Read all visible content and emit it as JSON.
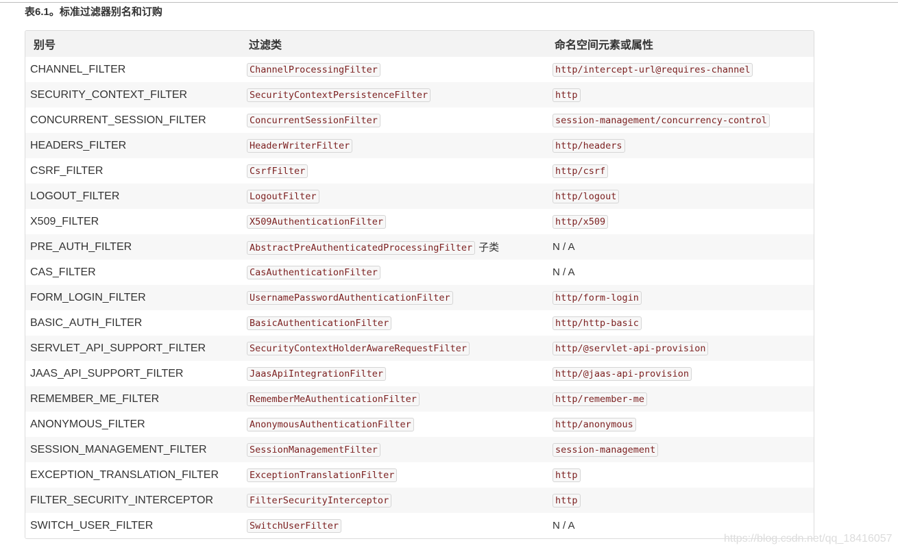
{
  "caption": "表6.1。标准过滤器别名和订购",
  "table": {
    "headers": [
      "别号",
      "过滤类",
      "命名空间元素或属性"
    ],
    "rows": [
      {
        "alias": "CHANNEL_FILTER",
        "filter_class": "ChannelProcessingFilter",
        "filter_suffix": "",
        "namespace": "http/intercept-url@requires-channel",
        "namespace_is_code": true
      },
      {
        "alias": "SECURITY_CONTEXT_FILTER",
        "filter_class": "SecurityContextPersistenceFilter",
        "filter_suffix": "",
        "namespace": "http",
        "namespace_is_code": true
      },
      {
        "alias": "CONCURRENT_SESSION_FILTER",
        "filter_class": "ConcurrentSessionFilter",
        "filter_suffix": "",
        "namespace": "session-management/concurrency-control",
        "namespace_is_code": true
      },
      {
        "alias": "HEADERS_FILTER",
        "filter_class": "HeaderWriterFilter",
        "filter_suffix": "",
        "namespace": "http/headers",
        "namespace_is_code": true
      },
      {
        "alias": "CSRF_FILTER",
        "filter_class": "CsrfFilter",
        "filter_suffix": "",
        "namespace": "http/csrf",
        "namespace_is_code": true
      },
      {
        "alias": "LOGOUT_FILTER",
        "filter_class": "LogoutFilter",
        "filter_suffix": "",
        "namespace": "http/logout",
        "namespace_is_code": true
      },
      {
        "alias": "X509_FILTER",
        "filter_class": "X509AuthenticationFilter",
        "filter_suffix": "",
        "namespace": "http/x509",
        "namespace_is_code": true
      },
      {
        "alias": "PRE_AUTH_FILTER",
        "filter_class": "AbstractPreAuthenticatedProcessingFilter",
        "filter_suffix": "子类",
        "namespace": "N / A",
        "namespace_is_code": false
      },
      {
        "alias": "CAS_FILTER",
        "filter_class": "CasAuthenticationFilter",
        "filter_suffix": "",
        "namespace": "N / A",
        "namespace_is_code": false
      },
      {
        "alias": "FORM_LOGIN_FILTER",
        "filter_class": "UsernamePasswordAuthenticationFilter",
        "filter_suffix": "",
        "namespace": "http/form-login",
        "namespace_is_code": true
      },
      {
        "alias": "BASIC_AUTH_FILTER",
        "filter_class": "BasicAuthenticationFilter",
        "filter_suffix": "",
        "namespace": "http/http-basic",
        "namespace_is_code": true
      },
      {
        "alias": "SERVLET_API_SUPPORT_FILTER",
        "filter_class": "SecurityContextHolderAwareRequestFilter",
        "filter_suffix": "",
        "namespace": "http/@servlet-api-provision",
        "namespace_is_code": true
      },
      {
        "alias": "JAAS_API_SUPPORT_FILTER",
        "filter_class": "JaasApiIntegrationFilter",
        "filter_suffix": "",
        "namespace": "http/@jaas-api-provision",
        "namespace_is_code": true
      },
      {
        "alias": "REMEMBER_ME_FILTER",
        "filter_class": "RememberMeAuthenticationFilter",
        "filter_suffix": "",
        "namespace": "http/remember-me",
        "namespace_is_code": true
      },
      {
        "alias": "ANONYMOUS_FILTER",
        "filter_class": "AnonymousAuthenticationFilter",
        "filter_suffix": "",
        "namespace": "http/anonymous",
        "namespace_is_code": true
      },
      {
        "alias": "SESSION_MANAGEMENT_FILTER",
        "filter_class": "SessionManagementFilter",
        "filter_suffix": "",
        "namespace": "session-management",
        "namespace_is_code": true
      },
      {
        "alias": "EXCEPTION_TRANSLATION_FILTER",
        "filter_class": "ExceptionTranslationFilter",
        "filter_suffix": "",
        "namespace": "http",
        "namespace_is_code": true
      },
      {
        "alias": "FILTER_SECURITY_INTERCEPTOR",
        "filter_class": "FilterSecurityInterceptor",
        "filter_suffix": "",
        "namespace": "http",
        "namespace_is_code": true
      },
      {
        "alias": "SWITCH_USER_FILTER",
        "filter_class": "SwitchUserFilter",
        "filter_suffix": "",
        "namespace": "N / A",
        "namespace_is_code": false
      }
    ]
  },
  "watermark": "https://blog.csdn.net/qq_18416057",
  "colors": {
    "code_text": "#7b1f1f",
    "header_bg": "#f3f3f3",
    "stripe_bg": "#f7f7f7"
  }
}
